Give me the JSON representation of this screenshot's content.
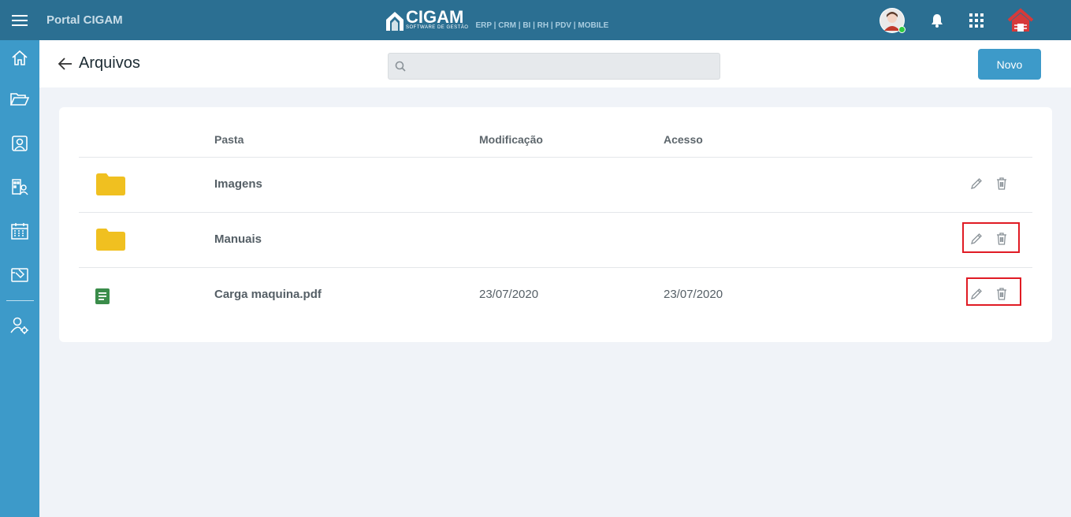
{
  "topbar": {
    "brand": "Portal CIGAM",
    "logo_word": "CIGAM",
    "logo_sub": "SOFTWARE DE GESTÃO",
    "logo_products": "ERP | CRM | BI | RH | PDV | MOBILE",
    "icons": [
      "menu-icon",
      "user-avatar",
      "bell-icon",
      "apps-grid-icon",
      "home-logo-icon"
    ],
    "colors": {
      "bar": "#2b6f92",
      "sidebar": "#3d9ac9",
      "status": "#2ecc40"
    }
  },
  "sidebar": {
    "items": [
      "home-icon",
      "folder-open-icon",
      "contacts-icon",
      "org-chart-icon",
      "calendar-icon",
      "ticket-icon",
      "user-settings-icon"
    ]
  },
  "header": {
    "title": "Arquivos",
    "search_placeholder": "",
    "new_button": "Novo"
  },
  "table": {
    "columns": {
      "pasta": "Pasta",
      "modificacao": "Modificação",
      "acesso": "Acesso"
    },
    "rows": [
      {
        "type": "folder",
        "name": "Imagens",
        "modified": "",
        "accessed": ""
      },
      {
        "type": "folder",
        "name": "Manuais",
        "modified": "",
        "accessed": ""
      },
      {
        "type": "file",
        "name": "Carga maquina.pdf",
        "modified": "23/07/2020",
        "accessed": "23/07/2020"
      }
    ],
    "colors": {
      "folder": "#f0c020",
      "file": "#3a8c4a",
      "highlight": "#e01b24"
    }
  }
}
